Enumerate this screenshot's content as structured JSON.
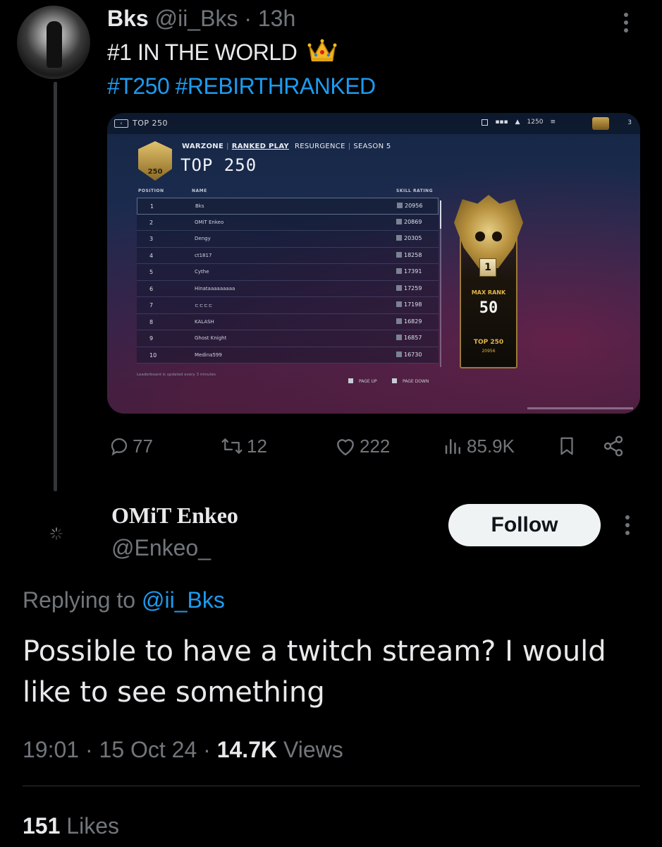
{
  "parent_tweet": {
    "author_name": "Bks",
    "author_handle": "@ii_Bks",
    "separator": "·",
    "time_ago": "13h",
    "text": "#1 IN THE WORLD",
    "hashtags": "#T250 #REBIRTHRANKED",
    "stats": {
      "replies": "77",
      "reposts": "12",
      "likes": "222",
      "views": "85.9K"
    }
  },
  "game_screenshot": {
    "top_bar_title": "TOP 250",
    "top_bar_sr": "1250",
    "top_bar_count": "3",
    "brand": "WARZONE",
    "mode": "RANKED PLAY",
    "playlist": "RESURGENCE",
    "season": "SEASON 5",
    "title": "TOP 250",
    "emblem_label": "250",
    "columns": {
      "position": "POSITION",
      "name": "NAME",
      "skill_rating": "SKILL RATING"
    },
    "rows": [
      {
        "position": "1",
        "name": "Bks",
        "sr": "20956"
      },
      {
        "position": "2",
        "name": "OMiT Enkeo",
        "sr": "20869"
      },
      {
        "position": "3",
        "name": "Dengy",
        "sr": "20305"
      },
      {
        "position": "4",
        "name": "ct1817",
        "sr": "18258"
      },
      {
        "position": "5",
        "name": "Cythe",
        "sr": "17391"
      },
      {
        "position": "6",
        "name": "Hinataaaaaaaaa",
        "sr": "17259"
      },
      {
        "position": "7",
        "name": "ㄷㄷㄷㄷ",
        "sr": "17198"
      },
      {
        "position": "8",
        "name": "KALASH",
        "sr": "16829"
      },
      {
        "position": "9",
        "name": "Ghost Knight",
        "sr": "16857"
      },
      {
        "position": "10",
        "name": "Medina599",
        "sr": "16730"
      }
    ],
    "footer_note": "Leaderboard is updated every 3 minutes",
    "page_up": "PAGE UP",
    "page_down": "PAGE DOWN",
    "card": {
      "rank_plaque": "1",
      "max_rank_label": "MAX RANK",
      "max_rank_value": "50",
      "top_label": "TOP 250",
      "sr": "20956"
    }
  },
  "reply": {
    "author_name": "OMiT Enkeo",
    "author_handle": "@Enkeo_",
    "follow_label": "Follow",
    "replying_prefix": "Replying to",
    "replying_handle": "@ii_Bks",
    "text": "Possible to have a twitch stream? I would like to see something",
    "time": "19:01",
    "date": "15 Oct 24",
    "views_count": "14.7K",
    "views_label": "Views",
    "likes_count": "151",
    "likes_label": "Likes"
  },
  "colors": {
    "background": "#000000",
    "text_primary": "#e7e9ea",
    "text_secondary": "#71767b",
    "link": "#1d9bf0",
    "follow_bg": "#eff3f4"
  },
  "icons": [
    "more-icon",
    "crown-emoji-icon",
    "reply-icon",
    "repost-icon",
    "like-icon",
    "views-icon",
    "bookmark-icon",
    "share-icon",
    "loading-spinner-icon"
  ]
}
